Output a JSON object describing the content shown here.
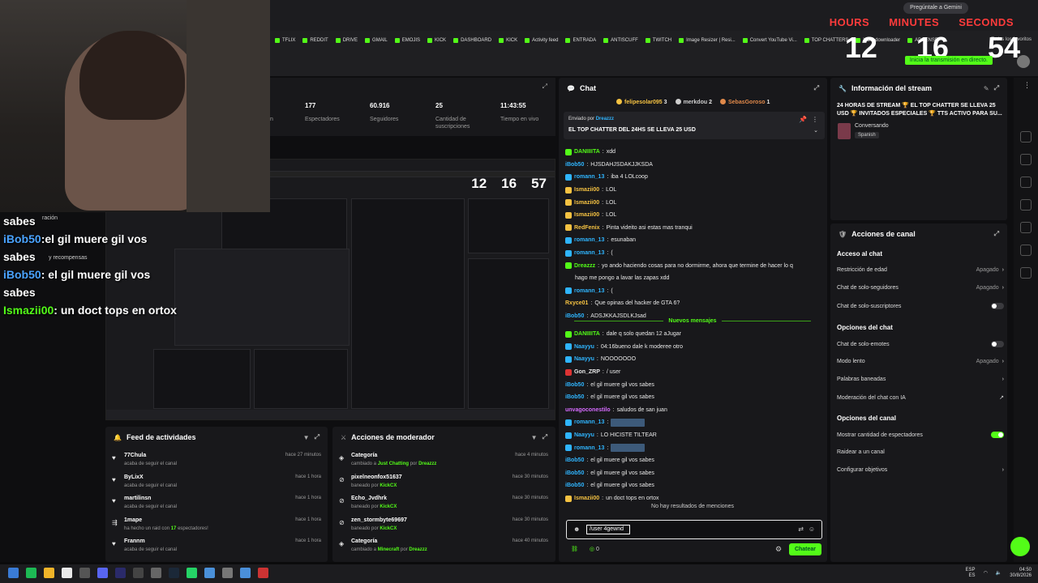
{
  "browser": {
    "gemini_label": "Pregúntale a Gemini",
    "bookmarks": [
      "TFLIX",
      "REDDIT",
      "DRIVE",
      "GMAIL",
      "EMOJIS",
      "KICK",
      "DASHBOARD",
      "KICK",
      "Activity feed",
      "ENTRADA",
      "ANTISCUFF",
      "TWITCH",
      "Image Resizer | Resi...",
      "Convert YouTube Vi...",
      "TOP CHATTERS",
      "VOD downloader",
      "ADSENSE"
    ],
    "favorites_label": "Todos los favoritos"
  },
  "timer": {
    "hours_label": "HOURS",
    "minutes_label": "MINUTES",
    "seconds_label": "SECONDS",
    "hours": "12",
    "minutes": "16",
    "seconds": "54",
    "go_live": "Inicia la transmisión en directo."
  },
  "stats": [
    {
      "value": "177",
      "label": "Espectadores"
    },
    {
      "value": "60.916",
      "label": "Seguidores"
    },
    {
      "value": "25",
      "label": "Cantidad de suscripciones"
    },
    {
      "value": "11:43:55",
      "label": "Tiempo en vivo"
    }
  ],
  "stats_partial_label": "n",
  "preview": {
    "hours": "12",
    "minutes": "16",
    "seconds": "57"
  },
  "webcam_overlay": {
    "line0": "sabes",
    "partial_label": "ración",
    "lines": [
      {
        "user": "iBob50",
        "text": "el gil muere gil vos sabes"
      },
      {
        "user": "iBob50",
        "text": "el gil muere gil vos sabes"
      },
      {
        "user": "Ismazii00",
        "text": "un doct tops en ortox"
      }
    ],
    "bg_text": "y recompensas"
  },
  "chat": {
    "title": "Chat",
    "top_chatters": [
      {
        "name": "felipesolar095",
        "count": "3"
      },
      {
        "name": "merkdou",
        "count": "2"
      },
      {
        "name": "SebasGoroso",
        "count": "1"
      }
    ],
    "pinned_by_label": "Enviado por",
    "pinned_by_user": "Dreazzz",
    "pinned_text": "EL TOP CHATTER DEL 24HS SE LLEVA 25 USD",
    "messages": [
      {
        "user": "DANIIIITA",
        "text": "xdd",
        "color": "#53fc18",
        "badge": "b1"
      },
      {
        "user": "iBob50",
        "text": "HJSDAHJSDAKJJKSDA",
        "color": "#2fb5ff",
        "badge": ""
      },
      {
        "user": "romann_13",
        "text": "iba 4 LOLcoop",
        "color": "#2fb5ff",
        "badge": "b2"
      },
      {
        "user": "Ismazii00",
        "text": "LOL",
        "color": "#f5c242",
        "badge": "b3"
      },
      {
        "user": "Ismazii00",
        "text": "LOL",
        "color": "#f5c242",
        "badge": "b3"
      },
      {
        "user": "Ismazii00",
        "text": "LOL",
        "color": "#f5c242",
        "badge": "b3"
      },
      {
        "user": "RedFenix",
        "text": "Pinta videito asi estas mas tranqui",
        "color": "#f5c242",
        "badge": "b3"
      },
      {
        "user": "romann_13",
        "text": "esunaban",
        "color": "#2fb5ff",
        "badge": "b2"
      },
      {
        "user": "romann_13",
        "text": "(",
        "color": "#2fb5ff",
        "badge": "b2"
      },
      {
        "user": "Dreazzz",
        "text": "yo ando haciendo cosas para no dormirme, ahora que termine de hacer lo q",
        "color": "#53fc18",
        "badge": "b1"
      },
      {
        "user": "",
        "text": "hago me pongo a lavar las zapas xdd",
        "color": "#e8e8e8",
        "badge": ""
      },
      {
        "user": "romann_13",
        "text": "(",
        "color": "#2fb5ff",
        "badge": "b2"
      },
      {
        "user": "Rxyce01",
        "text": "Que opinas del hacker de GTA 6?",
        "color": "#f5c242",
        "badge": ""
      },
      {
        "user": "iBob50",
        "text": "ADSJKKAJSDLKJsad",
        "color": "#2fb5ff",
        "badge": ""
      }
    ],
    "new_messages_label": "Nuevos mensajes",
    "messages_new": [
      {
        "user": "DANIIIITA",
        "text": "dale q solo quedan 12 aJugar",
        "color": "#53fc18",
        "badge": "b1"
      },
      {
        "user": "Naayyu",
        "text": "04:16bueno dale k moderee otro",
        "color": "#2fb5ff",
        "badge": "b2"
      },
      {
        "user": "Naayyu",
        "text": "NOOOOOOO",
        "color": "#2fb5ff",
        "badge": "b2"
      },
      {
        "user": "Gon_ZRP",
        "text": "/ user",
        "color": "#e8e8e8",
        "badge": "b4"
      },
      {
        "user": "iBob50",
        "text": "el gil muere gil vos sabes",
        "color": "#2fb5ff",
        "badge": ""
      },
      {
        "user": "iBob50",
        "text": "el gil muere gil vos sabes",
        "color": "#2fb5ff",
        "badge": ""
      },
      {
        "user": "unvagoconestilo",
        "text": "saludos de san juan",
        "color": "#d66bff",
        "badge": ""
      },
      {
        "user": "romann_13",
        "text": "",
        "color": "#2fb5ff",
        "badge": "b2"
      },
      {
        "user": "Naayyu",
        "text": "LO HICISTE TILTEAR",
        "color": "#2fb5ff",
        "badge": "b2"
      },
      {
        "user": "romann_13",
        "text": "",
        "color": "#2fb5ff",
        "badge": "b2"
      },
      {
        "user": "iBob50",
        "text": "el gil muere gil vos sabes",
        "color": "#2fb5ff",
        "badge": ""
      },
      {
        "user": "iBob50",
        "text": "el gil muere gil vos sabes",
        "color": "#2fb5ff",
        "badge": ""
      },
      {
        "user": "iBob50",
        "text": "el gil muere gil vos sabes",
        "color": "#2fb5ff",
        "badge": ""
      },
      {
        "user": "Ismazii00",
        "text": "un doct tops en ortox",
        "color": "#f5c242",
        "badge": "b3"
      }
    ],
    "no_mentions": "No hay resultados de menciones",
    "input_value": "/user 4gewnd",
    "points": "0",
    "send_label": "Chatear"
  },
  "stream_info": {
    "title": "Información del stream",
    "stream_title": "24 HORAS DE STREAM 🏆 EL TOP CHATTER SE LLEVA 25 USD 🏆 INVITADOS ESPECIALES 🏆 TTS ACTIVO PARA SU...",
    "category": "Conversando",
    "language": "Spanish"
  },
  "channel_actions": {
    "title": "Acciones de canal",
    "chat_access": "Acceso al chat",
    "age_restriction": "Restricción de edad",
    "age_restriction_state": "Apagado",
    "followers_only": "Chat de solo-seguidores",
    "followers_only_state": "Apagado",
    "subs_only": "Chat de solo-suscriptores",
    "chat_options": "Opciones del chat",
    "emotes_only": "Chat de solo-emotes",
    "slow_mode": "Modo lento",
    "slow_mode_state": "Apagado",
    "banned_words": "Palabras baneadas",
    "ai_moderation": "Moderación del chat con IA",
    "channel_options": "Opciones del canal",
    "show_viewers": "Mostrar cantidad de espectadores",
    "raid": "Raidear a un canal",
    "goals": "Configurar objetivos"
  },
  "feed": {
    "title": "Feed de actividades",
    "items": [
      {
        "name": "77Chula",
        "desc": "acaba de seguir el canal",
        "extra": "",
        "time": "hace 27 minutos",
        "icon": "heart"
      },
      {
        "name": "ByLixX",
        "desc": "acaba de seguir el canal",
        "extra": "",
        "time": "hace 1 hora",
        "icon": "heart"
      },
      {
        "name": "martilinsn",
        "desc": "acaba de seguir el canal",
        "extra": "",
        "time": "hace 1 hora",
        "icon": "heart"
      },
      {
        "name": "1mape",
        "desc": "ha hecho un raid con",
        "extra": "17",
        "extra_after": "espectadores!",
        "time": "hace 1 hora",
        "icon": "raid"
      },
      {
        "name": "Frannm",
        "desc": "acaba de seguir el canal",
        "extra": "",
        "time": "hace 1 hora",
        "icon": "heart"
      }
    ]
  },
  "mod": {
    "title": "Acciones de moderador",
    "items": [
      {
        "name": "Categoría",
        "desc": "cambiado a",
        "hl1": "Just Chatting",
        "mid": "por",
        "hl2": "Dreazzz",
        "time": "hace 4 minutos",
        "icon": "tag"
      },
      {
        "name": "pixelneonfox51637",
        "desc": "baneado por",
        "hl1": "KickCX",
        "mid": "",
        "hl2": "",
        "time": "hace 30 minutos",
        "icon": "ban"
      },
      {
        "name": "Echo_Jvdhrk",
        "desc": "baneado por",
        "hl1": "KickCX",
        "mid": "",
        "hl2": "",
        "time": "hace 30 minutos",
        "icon": "ban"
      },
      {
        "name": "zen_stormbyte69697",
        "desc": "baneado por",
        "hl1": "KickCX",
        "mid": "",
        "hl2": "",
        "time": "hace 30 minutos",
        "icon": "ban"
      },
      {
        "name": "Categoría",
        "desc": "cambiado a",
        "hl1": "Minecraft",
        "mid": "por",
        "hl2": "Dreazzz",
        "time": "hace 40 minutos",
        "icon": "tag"
      }
    ]
  },
  "tray": {
    "lang": "ESP",
    "lang2": "ES",
    "time": "04:50",
    "date": "30/8/2026"
  },
  "colors": {
    "accent": "#53fc18",
    "panel": "#18181b",
    "timer_label": "#ff3b3b"
  }
}
